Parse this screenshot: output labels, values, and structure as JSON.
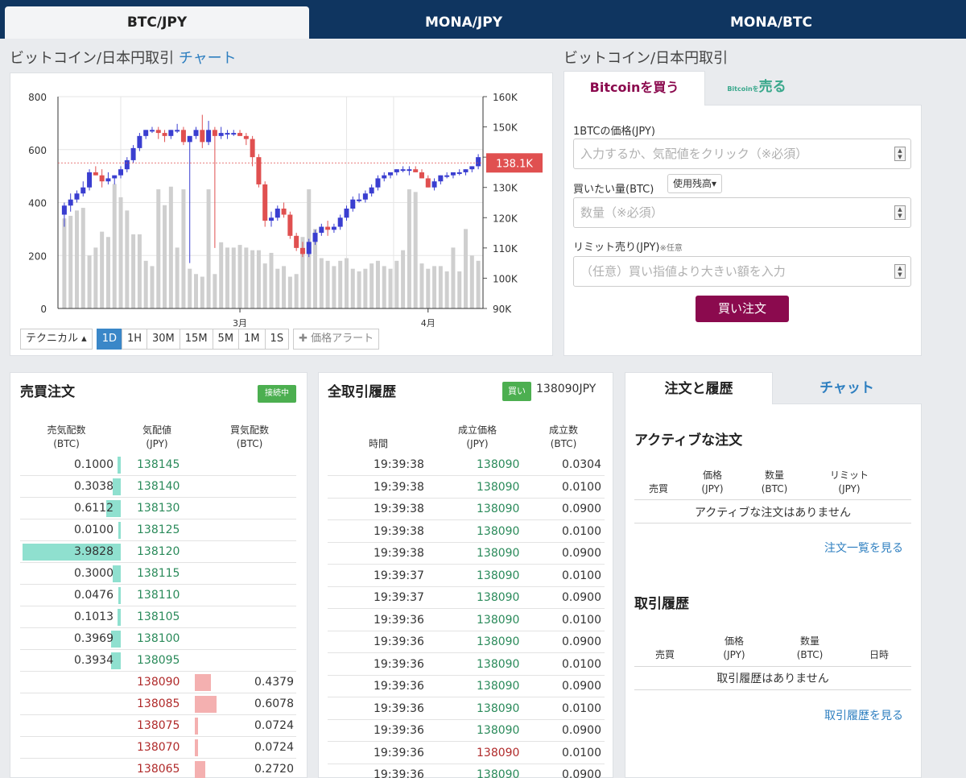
{
  "tabs": [
    "BTC/JPY",
    "MONA/JPY",
    "MONA/BTC"
  ],
  "chart_section": {
    "title": "ビットコイン/日本円取引",
    "link": "チャート"
  },
  "form_section_title": "ビットコイン/日本円取引",
  "chart_data": {
    "type": "candlestick",
    "left_axis": {
      "ticks": [
        0,
        200,
        400,
        600,
        800
      ],
      "ylim": [
        0,
        800
      ]
    },
    "right_axis": {
      "ticks": [
        "90K",
        "100K",
        "110K",
        "120K",
        "130K",
        "140K",
        "150K",
        "160K"
      ],
      "ylim": [
        90000,
        160000
      ]
    },
    "x_labels": [
      "3月",
      "4月"
    ],
    "current_price_label": "138.1K",
    "current_price": 138100,
    "candles": [
      [
        121,
        125,
        117,
        124
      ],
      [
        124,
        128,
        122,
        126
      ],
      [
        126,
        129,
        125,
        128
      ],
      [
        128,
        132,
        127,
        130
      ],
      [
        130,
        136,
        129,
        135
      ],
      [
        135,
        137,
        134,
        134
      ],
      [
        134,
        136,
        130,
        132
      ],
      [
        132,
        135,
        131,
        133
      ],
      [
        133,
        134,
        131,
        134
      ],
      [
        134,
        137,
        133,
        136
      ],
      [
        136,
        140,
        135,
        139
      ],
      [
        139,
        144,
        138,
        143
      ],
      [
        143,
        148,
        142,
        147
      ],
      [
        147,
        149,
        146,
        149
      ],
      [
        149,
        150,
        148,
        149
      ],
      [
        149,
        150,
        146,
        148
      ],
      [
        148,
        149,
        145,
        147
      ],
      [
        147,
        149,
        146,
        149
      ],
      [
        149,
        151,
        148,
        149
      ],
      [
        149,
        150,
        144,
        145
      ],
      [
        145,
        147,
        105,
        147
      ],
      [
        147,
        150,
        146,
        149
      ],
      [
        149,
        154,
        143,
        145
      ],
      [
        145,
        152,
        144,
        149
      ],
      [
        149,
        150,
        110,
        147
      ],
      [
        147,
        150,
        146,
        148
      ],
      [
        148,
        149,
        146,
        148
      ],
      [
        148,
        149,
        147,
        148
      ],
      [
        148,
        149,
        147,
        147
      ],
      [
        147,
        148,
        144,
        146
      ],
      [
        146,
        147,
        137,
        140
      ],
      [
        140,
        141,
        130,
        131
      ],
      [
        131,
        132,
        117,
        119
      ],
      [
        119,
        122,
        117,
        120
      ],
      [
        120,
        124,
        119,
        123
      ],
      [
        123,
        125,
        120,
        121
      ],
      [
        121,
        122,
        113,
        114
      ],
      [
        114,
        115,
        109,
        110
      ],
      [
        110,
        112,
        107,
        108
      ],
      [
        108,
        113,
        107,
        112
      ],
      [
        112,
        116,
        111,
        115
      ],
      [
        115,
        118,
        114,
        117
      ],
      [
        117,
        119,
        114,
        116
      ],
      [
        116,
        118,
        115,
        117
      ],
      [
        117,
        121,
        116,
        120
      ],
      [
        120,
        124,
        119,
        123
      ],
      [
        123,
        127,
        122,
        126
      ],
      [
        126,
        128,
        125,
        126
      ],
      [
        126,
        129,
        125,
        128
      ],
      [
        128,
        131,
        127,
        130
      ],
      [
        130,
        134,
        129,
        133
      ],
      [
        133,
        135,
        132,
        134
      ],
      [
        134,
        135,
        133,
        135
      ],
      [
        135,
        136,
        134,
        136
      ],
      [
        136,
        137,
        135,
        136
      ],
      [
        136,
        137,
        134,
        136
      ],
      [
        136,
        137,
        135,
        135
      ],
      [
        135,
        136,
        133,
        133
      ],
      [
        133,
        134,
        130,
        130
      ],
      [
        130,
        133,
        129,
        132
      ],
      [
        132,
        134,
        131,
        134
      ],
      [
        134,
        135,
        133,
        134
      ],
      [
        134,
        135,
        133,
        135
      ],
      [
        135,
        136,
        134,
        135
      ],
      [
        135,
        136,
        134,
        136
      ],
      [
        136,
        137,
        135,
        137
      ],
      [
        137,
        141,
        136,
        140
      ]
    ],
    "volumes": [
      340,
      350,
      370,
      380,
      200,
      230,
      290,
      270,
      470,
      420,
      370,
      280,
      280,
      180,
      160,
      450,
      390,
      460,
      230,
      450,
      150,
      130,
      120,
      450,
      130,
      250,
      230,
      230,
      240,
      230,
      220,
      220,
      170,
      210,
      150,
      160,
      120,
      130,
      270,
      450,
      300,
      190,
      180,
      160,
      180,
      190,
      150,
      140,
      150,
      170,
      180,
      160,
      150,
      180,
      220,
      450,
      440,
      170,
      150,
      160,
      160,
      140,
      230,
      140,
      300,
      200,
      180
    ]
  },
  "chart_tools": {
    "technical": "テクニカル",
    "intervals": [
      "1D",
      "1H",
      "30M",
      "15M",
      "5M",
      "1M",
      "1S"
    ],
    "active_interval": "1D",
    "alert": "価格アラート"
  },
  "order_form": {
    "buy_tab": "Bitcoinを買う",
    "sell_tab_small": "Bitcoinを",
    "sell_tab": "売る",
    "price_label": "1BTCの価格(JPY)",
    "price_placeholder": "入力するか、気配値をクリック（※必須）",
    "amount_label": "買いたい量(BTC)",
    "balance_btn": "使用残高",
    "amount_placeholder": "数量（※必須）",
    "limit_label": "リミット売り(JPY)",
    "limit_optional": "※任意",
    "limit_placeholder": "（任意）買い指値より大きい額を入力",
    "submit": "買い注文"
  },
  "orderbook": {
    "title": "売買注文",
    "status": "接続中",
    "headers": {
      "ask_qty": "売気配数",
      "ask_qty_unit": "(BTC)",
      "price": "気配値",
      "price_unit": "(JPY)",
      "bid_qty": "買気配数",
      "bid_qty_unit": "(BTC)"
    },
    "asks": [
      {
        "qty": "0.1000",
        "price": "138145",
        "bar": 0.03
      },
      {
        "qty": "0.3038",
        "price": "138140",
        "bar": 0.08
      },
      {
        "qty": "0.6112",
        "price": "138130",
        "bar": 0.15
      },
      {
        "qty": "0.0100",
        "price": "138125",
        "bar": 0.01
      },
      {
        "qty": "3.9828",
        "price": "138120",
        "bar": 1.0
      },
      {
        "qty": "0.3000",
        "price": "138115",
        "bar": 0.08
      },
      {
        "qty": "0.0476",
        "price": "138110",
        "bar": 0.02
      },
      {
        "qty": "0.1013",
        "price": "138105",
        "bar": 0.03
      },
      {
        "qty": "0.3969",
        "price": "138100",
        "bar": 0.1
      },
      {
        "qty": "0.3934",
        "price": "138095",
        "bar": 0.1
      }
    ],
    "bids": [
      {
        "price": "138090",
        "qty": "0.4379",
        "bar": 0.11
      },
      {
        "price": "138085",
        "qty": "0.6078",
        "bar": 0.15
      },
      {
        "price": "138075",
        "qty": "0.0724",
        "bar": 0.02
      },
      {
        "price": "138070",
        "qty": "0.0724",
        "bar": 0.02
      },
      {
        "price": "138065",
        "qty": "0.2720",
        "bar": 0.07
      }
    ]
  },
  "trades": {
    "title": "全取引履歴",
    "last_side": "買い",
    "last_price": "138090JPY",
    "headers": {
      "time": "時間",
      "price": "成立価格",
      "price_unit": "(JPY)",
      "qty": "成立数",
      "qty_unit": "(BTC)"
    },
    "rows": [
      {
        "time": "19:39:38",
        "price": "138090",
        "qty": "0.0304",
        "side": "buy"
      },
      {
        "time": "19:39:38",
        "price": "138090",
        "qty": "0.0100",
        "side": "buy"
      },
      {
        "time": "19:39:38",
        "price": "138090",
        "qty": "0.0900",
        "side": "buy"
      },
      {
        "time": "19:39:38",
        "price": "138090",
        "qty": "0.0100",
        "side": "buy"
      },
      {
        "time": "19:39:38",
        "price": "138090",
        "qty": "0.0900",
        "side": "buy"
      },
      {
        "time": "19:39:37",
        "price": "138090",
        "qty": "0.0100",
        "side": "buy"
      },
      {
        "time": "19:39:37",
        "price": "138090",
        "qty": "0.0900",
        "side": "buy"
      },
      {
        "time": "19:39:36",
        "price": "138090",
        "qty": "0.0100",
        "side": "buy"
      },
      {
        "time": "19:39:36",
        "price": "138090",
        "qty": "0.0900",
        "side": "buy"
      },
      {
        "time": "19:39:36",
        "price": "138090",
        "qty": "0.0100",
        "side": "buy"
      },
      {
        "time": "19:39:36",
        "price": "138090",
        "qty": "0.0900",
        "side": "buy"
      },
      {
        "time": "19:39:36",
        "price": "138090",
        "qty": "0.0100",
        "side": "buy"
      },
      {
        "time": "19:39:36",
        "price": "138090",
        "qty": "0.0900",
        "side": "buy"
      },
      {
        "time": "19:39:36",
        "price": "138090",
        "qty": "0.0100",
        "side": "sell"
      },
      {
        "time": "19:39:36",
        "price": "138090",
        "qty": "0.0900",
        "side": "buy"
      }
    ]
  },
  "right_panel": {
    "tab_orders": "注文と履歴",
    "tab_chat": "チャット",
    "active_title": "アクティブな注文",
    "active_headers": [
      "売買",
      "価格",
      "(JPY)",
      "数量",
      "(BTC)",
      "リミット",
      "(JPY)"
    ],
    "active_empty": "アクティブな注文はありません",
    "active_link": "注文一覧を見る",
    "history_title": "取引履歴",
    "history_headers": [
      "売買",
      "価格",
      "(JPY)",
      "数量",
      "(BTC)",
      "日時"
    ],
    "history_empty": "取引履歴はありません",
    "history_link": "取引履歴を見る"
  },
  "colors": {
    "navy": "#0f3560",
    "up": "#3a3ed0",
    "down": "#e05050",
    "volume": "#cfcfcf",
    "ask_bar": "#8fe0cf",
    "bid_bar": "#f4b0b0",
    "buy": "#8b0a4e",
    "green": "#4caf50"
  }
}
